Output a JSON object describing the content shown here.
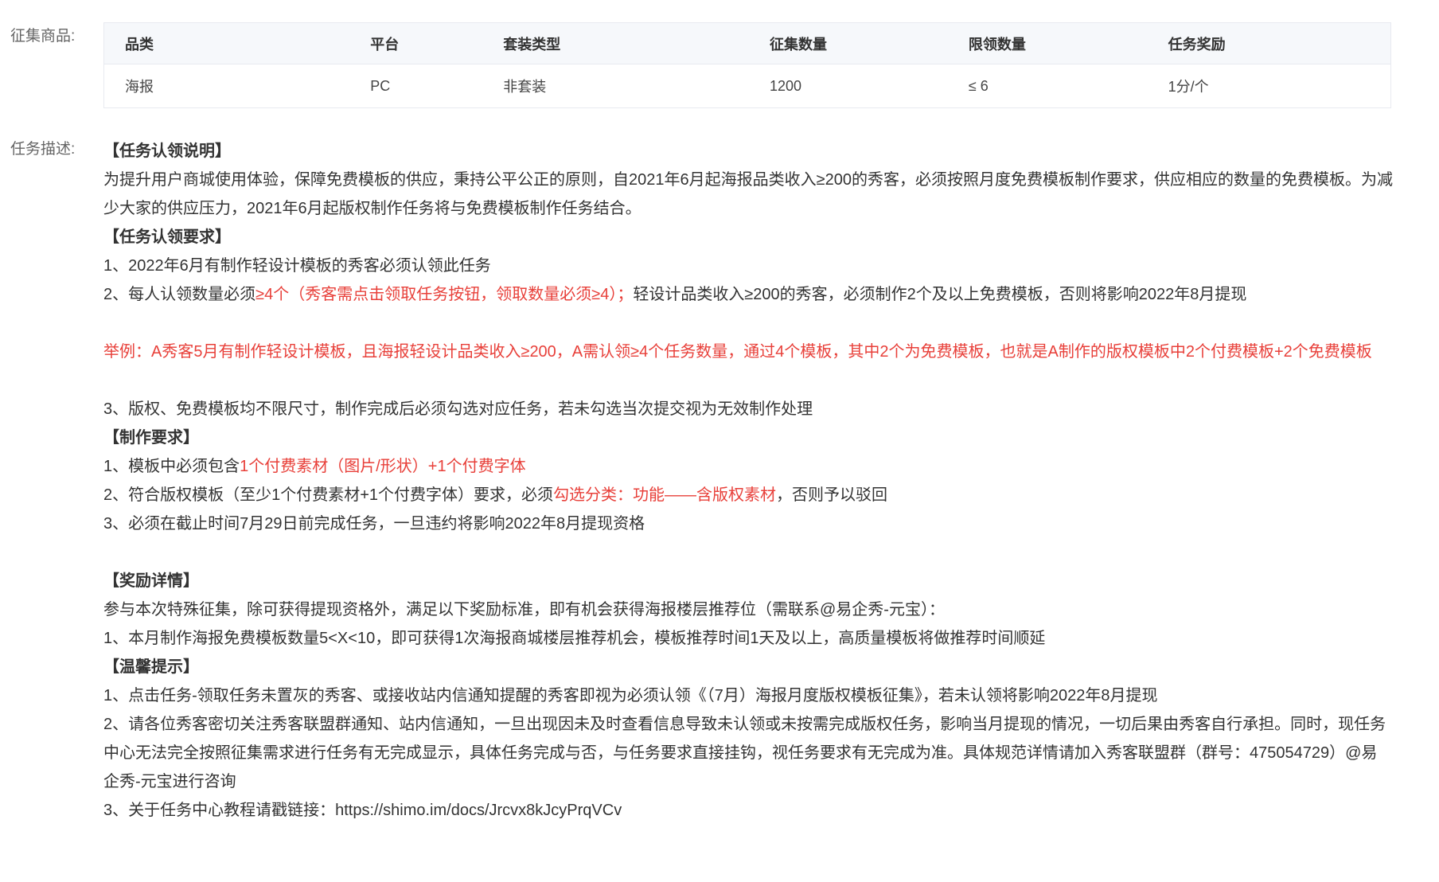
{
  "labels": {
    "goods": "征集商品:",
    "desc": "任务描述:"
  },
  "table": {
    "headers": [
      "品类",
      "平台",
      "套装类型",
      "征集数量",
      "限领数量",
      "任务奖励"
    ],
    "rows": [
      [
        "海报",
        "PC",
        "非套装",
        "1200",
        "≤ 6",
        "1分/个"
      ]
    ]
  },
  "description": {
    "h_claim": "【任务认领说明】",
    "claim_text": "为提升用户商城使用体验，保障免费模板的供应，秉持公平公正的原则，自2021年6月起海报品类收入≥200的秀客，必须按照月度免费模板制作要求，供应相应的数量的免费模板。为减少大家的供应压力，2021年6月起版权制作任务将与免费模板制作任务结合。",
    "h_claim_req": "【任务认领要求】",
    "req1": "1、2022年6月有制作轻设计模板的秀客必须认领此任务",
    "req2_a": "2、每人认领数量必须",
    "req2_red": "≥4个（秀客需点击领取任务按钮，领取数量必须≥4）；",
    "req2_b": "轻设计品类收入≥200的秀客，必须制作2个及以上免费模板，否则将影响2022年8月提现",
    "example": "举例：A秀客5月有制作轻设计模板，且海报轻设计品类收入≥200，A需认领≥4个任务数量，通过4个模板，其中2个为免费模板，也就是A制作的版权模板中2个付费模板+2个免费模板",
    "req3": "3、版权、免费模板均不限尺寸，制作完成后必须勾选对应任务，若未勾选当次提交视为无效制作处理",
    "h_make": "【制作要求】",
    "make1_a": "1、模板中必须包含",
    "make1_red": "1个付费素材（图片/形状）+1个付费字体",
    "make2_a": "2、符合版权模板（至少1个付费素材+1个付费字体）要求，必须",
    "make2_red": "勾选分类：功能——含版权素材",
    "make2_b": "，否则予以驳回",
    "make3": "3、必须在截止时间7月29日前完成任务，一旦违约将影响2022年8月提现资格",
    "h_reward": "【奖励详情】",
    "reward_text": "参与本次特殊征集，除可获得提现资格外，满足以下奖励标准，即有机会获得海报楼层推荐位（需联系@易企秀-元宝）：",
    "reward1": "1、本月制作海报免费模板数量5<X<10，即可获得1次海报商城楼层推荐机会，模板推荐时间1天及以上，高质量模板将做推荐时间顺延",
    "h_tips": "【温馨提示】",
    "tip1": "1、点击任务-领取任务未置灰的秀客、或接收站内信通知提醒的秀客即视为必须认领《（7月）海报月度版权模板征集》，若未认领将影响2022年8月提现",
    "tip2": "2、请各位秀客密切关注秀客联盟群通知、站内信通知，一旦出现因未及时查看信息导致未认领或未按需完成版权任务，影响当月提现的情况，一切后果由秀客自行承担。同时，现任务中心无法完全按照征集需求进行任务有无完成显示，具体任务完成与否，与任务要求直接挂钩，视任务要求有无完成为准。具体规范详情请加入秀客联盟群（群号：475054729）@易企秀-元宝进行咨询",
    "tip3": "3、关于任务中心教程请戳链接：https://shimo.im/docs/Jrcvx8kJcyPrqVCv"
  },
  "colors": {
    "highlight": "#e8403a",
    "table_header_bg": "#f6f8fb",
    "table_border": "#e8eaf0"
  }
}
